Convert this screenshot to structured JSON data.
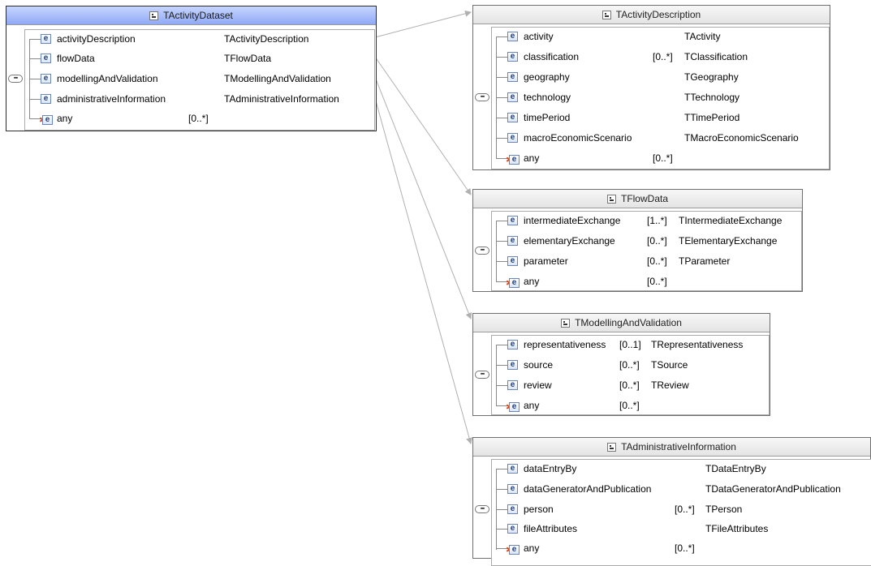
{
  "root": {
    "title": "TActivityDataset",
    "elements": [
      {
        "name": "activityDescription",
        "card": "",
        "type": "TActivityDescription"
      },
      {
        "name": "flowData",
        "card": "",
        "type": "TFlowData"
      },
      {
        "name": "modellingAndValidation",
        "card": "",
        "type": "TModellingAndValidation"
      },
      {
        "name": "administrativeInformation",
        "card": "",
        "type": "TAdministrativeInformation"
      }
    ],
    "any": {
      "name": "any",
      "card": "[0..*]"
    }
  },
  "activityDescription": {
    "title": "TActivityDescription",
    "elements": [
      {
        "name": "activity",
        "card": "",
        "type": "TActivity"
      },
      {
        "name": "classification",
        "card": "[0..*]",
        "type": "TClassification"
      },
      {
        "name": "geography",
        "card": "",
        "type": "TGeography"
      },
      {
        "name": "technology",
        "card": "",
        "type": "TTechnology"
      },
      {
        "name": "timePeriod",
        "card": "",
        "type": "TTimePeriod"
      },
      {
        "name": "macroEconomicScenario",
        "card": "",
        "type": "TMacroEconomicScenario"
      }
    ],
    "any": {
      "name": "any",
      "card": "[0..*]"
    }
  },
  "flowData": {
    "title": "TFlowData",
    "elements": [
      {
        "name": "intermediateExchange",
        "card": "[1..*]",
        "type": "TIntermediateExchange"
      },
      {
        "name": "elementaryExchange",
        "card": "[0..*]",
        "type": "TElementaryExchange"
      },
      {
        "name": "parameter",
        "card": "[0..*]",
        "type": "TParameter"
      }
    ],
    "any": {
      "name": "any",
      "card": "[0..*]"
    }
  },
  "modellingAndValidation": {
    "title": "TModellingAndValidation",
    "elements": [
      {
        "name": "representativeness",
        "card": "[0..1]",
        "type": "TRepresentativeness"
      },
      {
        "name": "source",
        "card": "[0..*]",
        "type": "TSource"
      },
      {
        "name": "review",
        "card": "[0..*]",
        "type": "TReview"
      }
    ],
    "any": {
      "name": "any",
      "card": "[0..*]"
    }
  },
  "administrativeInformation": {
    "title": "TAdministrativeInformation",
    "elements": [
      {
        "name": "dataEntryBy",
        "card": "",
        "type": "TDataEntryBy"
      },
      {
        "name": "dataGeneratorAndPublication",
        "card": "",
        "type": "TDataGeneratorAndPublication"
      },
      {
        "name": "person",
        "card": "[0..*]",
        "type": "TPerson"
      },
      {
        "name": "fileAttributes",
        "card": "",
        "type": "TFileAttributes"
      }
    ],
    "any": {
      "name": "any",
      "card": "[0..*]"
    }
  },
  "icons": {
    "complex_type": "complex-type-icon",
    "element": "element-icon",
    "any": "any-wildcard-icon",
    "sequence": "sequence-compositor-icon"
  },
  "colors": {
    "selected_header": "#8fa9f5",
    "element_icon_border": "#6a86b8",
    "any_star": "#d0471c",
    "connector": "#b0b0b0"
  }
}
